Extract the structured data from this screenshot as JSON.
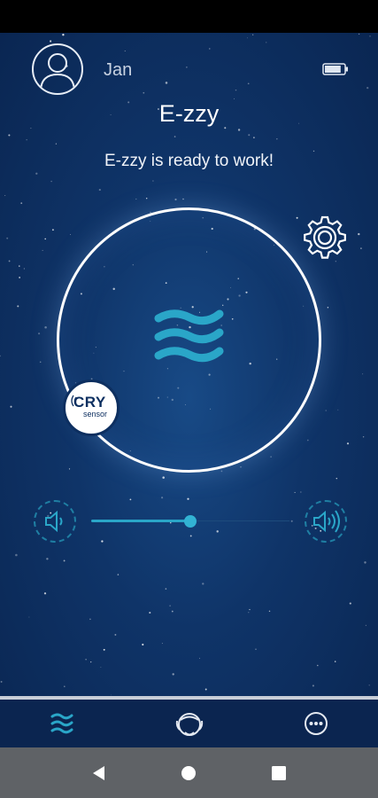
{
  "header": {
    "username": "Jan",
    "app_title": "E-zzy",
    "status_message": "E-zzy is ready to work!"
  },
  "battery": {
    "level": 0.85
  },
  "cry_sensor": {
    "main": "CRY",
    "sub": "sensor"
  },
  "volume": {
    "level": 0.5
  },
  "colors": {
    "accent": "#2aa6c8",
    "background": "#0f3468",
    "nav_background": "#0b2550",
    "system_nav": "#5f6266"
  },
  "bottom_nav": {
    "items": [
      {
        "icon": "waves-icon",
        "active": true
      },
      {
        "icon": "baby-head-icon",
        "active": false
      },
      {
        "icon": "more-icon",
        "active": false
      }
    ]
  },
  "system_nav": {
    "buttons": [
      "back",
      "home",
      "recents"
    ]
  }
}
